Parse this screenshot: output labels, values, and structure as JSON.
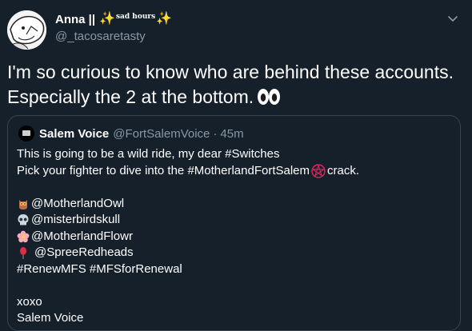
{
  "author": {
    "display_name": "Anna ||",
    "name_badge": "sad hours",
    "handle": "@_tacosaretasty"
  },
  "tweet": {
    "line1": "I'm so curious to know who are behind these accounts.",
    "line2": "Especially the 2 at the bottom."
  },
  "quote": {
    "name": "Salem Voice",
    "handle": "@FortSalemVoice",
    "separator": "·",
    "time": "45m",
    "line1": "This is going to be a wild ride, my dear #Switches",
    "line2_before": "Pick your fighter to dive into the #MotherlandFortSalem",
    "line2_after": "crack.",
    "accounts": [
      {
        "icon": "owl-icon",
        "handle": "@MotherlandOwl"
      },
      {
        "icon": "skull-icon",
        "handle": "@misterbirdskull"
      },
      {
        "icon": "flower-icon",
        "handle": "@MotherlandFlowr"
      },
      {
        "icon": "balloon-icon",
        "handle": "@SpreeRedheads"
      }
    ],
    "hashtags": "#RenewMFS #MFSforRenewal",
    "signoff": "xoxo",
    "signature": "Salem Voice"
  },
  "colors": {
    "background": "#15202b",
    "secondary_text": "#8899a6",
    "border": "#38444d",
    "pentagram": "#e0245e"
  }
}
